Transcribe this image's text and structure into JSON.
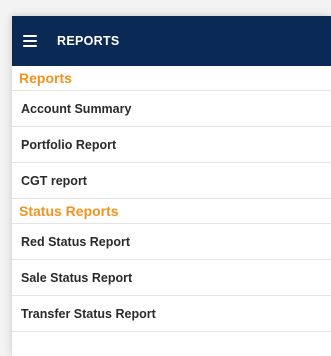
{
  "appbar": {
    "title": "REPORTS",
    "menu_icon": "hamburger-menu-icon",
    "background": "#0a2a55"
  },
  "sections": [
    {
      "header": "Reports",
      "items": [
        "Account Summary",
        "Portfolio Report",
        "CGT report"
      ]
    },
    {
      "header": "Status Reports",
      "items": [
        "Red Status Report",
        "Sale Status Report",
        "Transfer Status Report"
      ]
    }
  ],
  "colors": {
    "section_header": "#f0931f",
    "item_text": "#2b2b2b"
  }
}
